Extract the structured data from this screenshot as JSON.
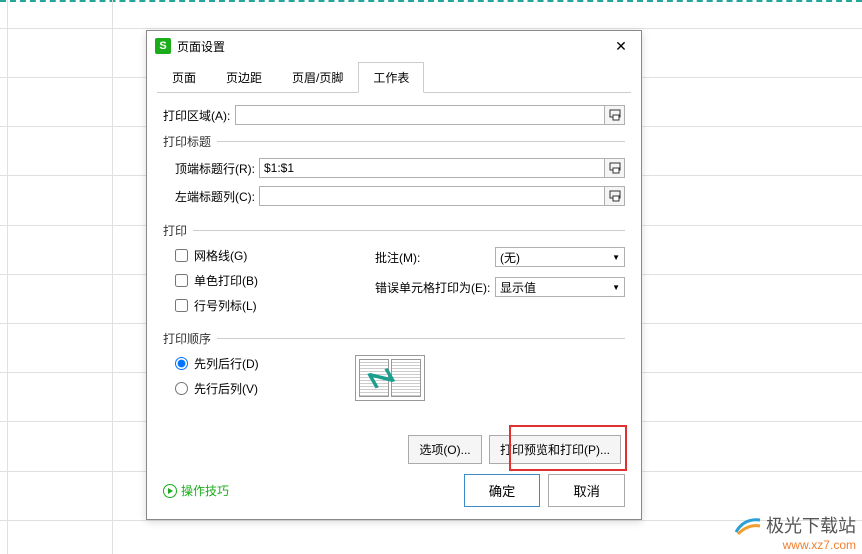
{
  "dialog": {
    "title": "页面设置",
    "tabs": [
      "页面",
      "页边距",
      "页眉/页脚",
      "工作表"
    ],
    "active_tab": 3
  },
  "print_area": {
    "label": "打印区域(A):",
    "value": ""
  },
  "print_titles": {
    "legend": "打印标题",
    "top_row_label": "顶端标题行(R):",
    "top_row_value": "$1:$1",
    "left_col_label": "左端标题列(C):",
    "left_col_value": ""
  },
  "print": {
    "legend": "打印",
    "gridlines": "网格线(G)",
    "black_white": "单色打印(B)",
    "row_col_headings": "行号列标(L)",
    "comments_label": "批注(M):",
    "comments_value": "(无)",
    "errors_label": "错误单元格打印为(E):",
    "errors_value": "显示值"
  },
  "order": {
    "legend": "打印顺序",
    "down_then_over": "先列后行(D)",
    "over_then_down": "先行后列(V)"
  },
  "buttons": {
    "options": "选项(O)...",
    "preview": "打印预览和打印(P)...",
    "tips": "操作技巧",
    "ok": "确定",
    "cancel": "取消"
  },
  "watermark": {
    "text": "极光下载站",
    "url": "www.xz7.com"
  }
}
